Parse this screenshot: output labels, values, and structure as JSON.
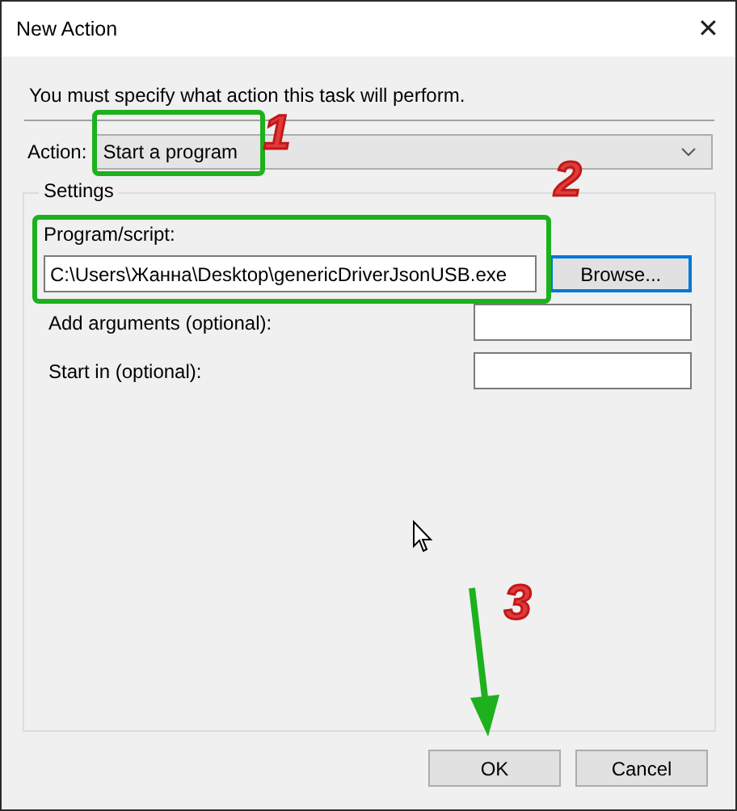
{
  "window": {
    "title": "New Action",
    "close": "✕"
  },
  "instruction": "You must specify what action this task will perform.",
  "action": {
    "label": "Action:",
    "value": "Start a program"
  },
  "settings": {
    "title": "Settings",
    "program_label": "Program/script:",
    "program_value": "C:\\Users\\Жанна\\Desktop\\genericDriverJsonUSB.exe",
    "browse": {
      "label": "Browse...",
      "focused": true
    },
    "arguments_label": "Add arguments (optional):",
    "start_in_label": "Start in (optional):"
  },
  "buttons": [
    "OK",
    "Cancel"
  ],
  "annotations": [
    {
      "label": "1"
    },
    {
      "label": "2"
    },
    {
      "label": "3"
    }
  ]
}
